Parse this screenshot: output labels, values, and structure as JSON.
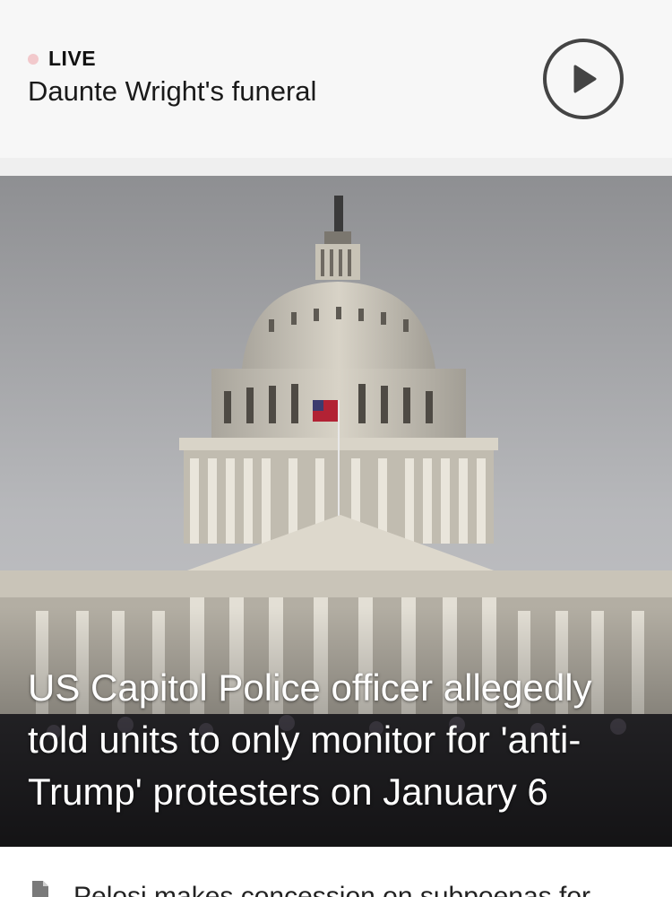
{
  "live": {
    "label": "LIVE",
    "title": "Daunte Wright's funeral",
    "dot_color": "#f2c9cc"
  },
  "hero": {
    "headline": "US Capitol Police officer allegedly told units to only monitor for 'anti-Trump' protesters on January 6",
    "image_description": "US Capitol dome photo"
  },
  "next_item": {
    "title": "Pelosi makes concession on subpoenas for",
    "icon": "document-icon"
  },
  "colors": {
    "page_bg": "#efefef",
    "card_bg": "#f7f7f7",
    "play_icon": "#444444"
  }
}
